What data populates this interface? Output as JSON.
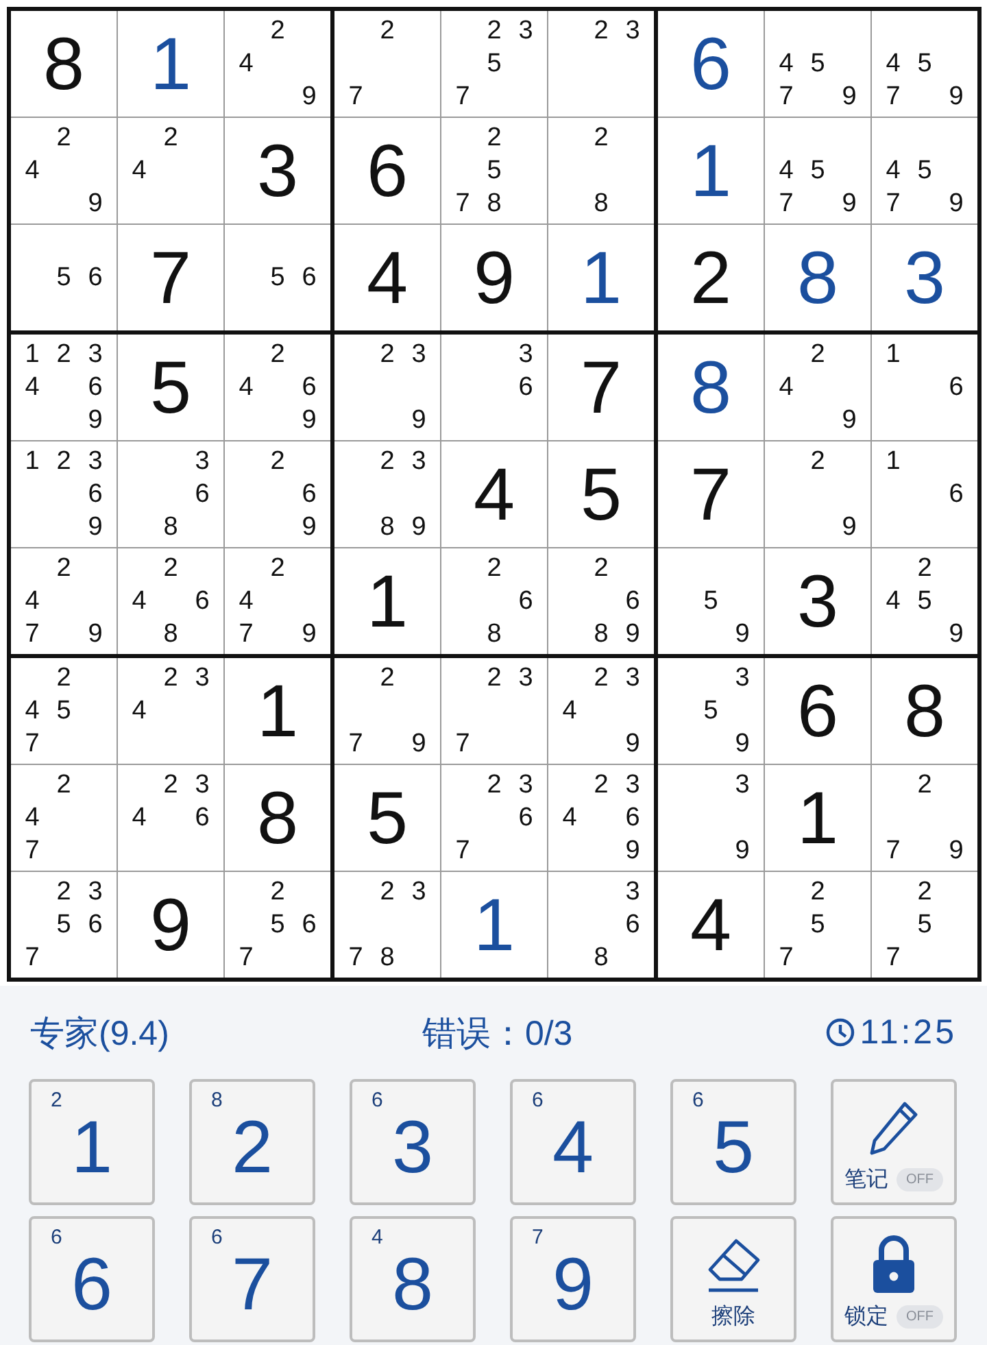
{
  "board": {
    "rows": [
      [
        {
          "kind": "given",
          "value": "8"
        },
        {
          "kind": "entered",
          "value": "1"
        },
        {
          "kind": "notes",
          "notes": [
            "2",
            "4",
            "9"
          ]
        },
        {
          "kind": "notes",
          "notes": [
            "2",
            "7"
          ]
        },
        {
          "kind": "notes",
          "notes": [
            "2",
            "3",
            "5",
            "7"
          ]
        },
        {
          "kind": "notes",
          "notes": [
            "2",
            "3"
          ]
        },
        {
          "kind": "entered",
          "value": "6"
        },
        {
          "kind": "notes",
          "notes": [
            "4",
            "5",
            "7",
            "9"
          ]
        },
        {
          "kind": "notes",
          "notes": [
            "4",
            "5",
            "7",
            "9"
          ]
        }
      ],
      [
        {
          "kind": "notes",
          "notes": [
            "2",
            "4",
            "9"
          ]
        },
        {
          "kind": "notes",
          "notes": [
            "2",
            "4"
          ]
        },
        {
          "kind": "given",
          "value": "3"
        },
        {
          "kind": "given",
          "value": "6"
        },
        {
          "kind": "notes",
          "notes": [
            "2",
            "5",
            "7",
            "8"
          ]
        },
        {
          "kind": "notes",
          "notes": [
            "2",
            "8"
          ]
        },
        {
          "kind": "entered",
          "value": "1"
        },
        {
          "kind": "notes",
          "notes": [
            "4",
            "5",
            "7",
            "9"
          ]
        },
        {
          "kind": "notes",
          "notes": [
            "4",
            "5",
            "7",
            "9"
          ]
        }
      ],
      [
        {
          "kind": "notes",
          "notes": [
            "5",
            "6"
          ]
        },
        {
          "kind": "given",
          "value": "7"
        },
        {
          "kind": "notes",
          "notes": [
            "5",
            "6"
          ]
        },
        {
          "kind": "given",
          "value": "4"
        },
        {
          "kind": "given",
          "value": "9"
        },
        {
          "kind": "entered",
          "value": "1"
        },
        {
          "kind": "given",
          "value": "2"
        },
        {
          "kind": "entered",
          "value": "8"
        },
        {
          "kind": "entered",
          "value": "3"
        }
      ],
      [
        {
          "kind": "notes",
          "notes": [
            "1",
            "2",
            "3",
            "4",
            "6",
            "9"
          ]
        },
        {
          "kind": "given",
          "value": "5"
        },
        {
          "kind": "notes",
          "notes": [
            "2",
            "4",
            "6",
            "9"
          ]
        },
        {
          "kind": "notes",
          "notes": [
            "2",
            "3",
            "9"
          ]
        },
        {
          "kind": "notes",
          "notes": [
            "3",
            "6"
          ]
        },
        {
          "kind": "given",
          "value": "7"
        },
        {
          "kind": "entered",
          "value": "8"
        },
        {
          "kind": "notes",
          "notes": [
            "2",
            "4",
            "9"
          ]
        },
        {
          "kind": "notes",
          "notes": [
            "1",
            "6"
          ]
        }
      ],
      [
        {
          "kind": "notes",
          "notes": [
            "1",
            "2",
            "3",
            "6",
            "9"
          ]
        },
        {
          "kind": "notes",
          "notes": [
            "3",
            "6",
            "8"
          ]
        },
        {
          "kind": "notes",
          "notes": [
            "2",
            "6",
            "9"
          ]
        },
        {
          "kind": "notes",
          "notes": [
            "2",
            "3",
            "8",
            "9"
          ]
        },
        {
          "kind": "given",
          "value": "4"
        },
        {
          "kind": "given",
          "value": "5"
        },
        {
          "kind": "given",
          "value": "7"
        },
        {
          "kind": "notes",
          "notes": [
            "2",
            "9"
          ]
        },
        {
          "kind": "notes",
          "notes": [
            "1",
            "6"
          ]
        }
      ],
      [
        {
          "kind": "notes",
          "notes": [
            "2",
            "4",
            "7",
            "9"
          ]
        },
        {
          "kind": "notes",
          "notes": [
            "2",
            "4",
            "6",
            "8"
          ]
        },
        {
          "kind": "notes",
          "notes": [
            "2",
            "4",
            "7",
            "9"
          ]
        },
        {
          "kind": "given",
          "value": "1"
        },
        {
          "kind": "notes",
          "notes": [
            "2",
            "6",
            "8"
          ]
        },
        {
          "kind": "notes",
          "notes": [
            "2",
            "6",
            "8",
            "9"
          ]
        },
        {
          "kind": "notes",
          "notes": [
            "5",
            "9"
          ]
        },
        {
          "kind": "given",
          "value": "3"
        },
        {
          "kind": "notes",
          "notes": [
            "2",
            "4",
            "5",
            "9"
          ]
        }
      ],
      [
        {
          "kind": "notes",
          "notes": [
            "2",
            "4",
            "5",
            "7"
          ]
        },
        {
          "kind": "notes",
          "notes": [
            "2",
            "3",
            "4"
          ]
        },
        {
          "kind": "given",
          "value": "1"
        },
        {
          "kind": "notes",
          "notes": [
            "2",
            "7",
            "9"
          ]
        },
        {
          "kind": "notes",
          "notes": [
            "2",
            "3",
            "7"
          ]
        },
        {
          "kind": "notes",
          "notes": [
            "2",
            "3",
            "4",
            "9"
          ]
        },
        {
          "kind": "notes",
          "notes": [
            "3",
            "5",
            "9"
          ]
        },
        {
          "kind": "given",
          "value": "6"
        },
        {
          "kind": "given",
          "value": "8"
        }
      ],
      [
        {
          "kind": "notes",
          "notes": [
            "2",
            "4",
            "7"
          ]
        },
        {
          "kind": "notes",
          "notes": [
            "2",
            "3",
            "4",
            "6"
          ]
        },
        {
          "kind": "given",
          "value": "8"
        },
        {
          "kind": "given",
          "value": "5"
        },
        {
          "kind": "notes",
          "notes": [
            "2",
            "3",
            "6",
            "7"
          ]
        },
        {
          "kind": "notes",
          "notes": [
            "2",
            "3",
            "4",
            "6",
            "9"
          ]
        },
        {
          "kind": "notes",
          "notes": [
            "3",
            "9"
          ]
        },
        {
          "kind": "given",
          "value": "1"
        },
        {
          "kind": "notes",
          "notes": [
            "2",
            "7",
            "9"
          ]
        }
      ],
      [
        {
          "kind": "notes",
          "notes": [
            "2",
            "3",
            "5",
            "6",
            "7"
          ]
        },
        {
          "kind": "given",
          "value": "9"
        },
        {
          "kind": "notes",
          "notes": [
            "2",
            "5",
            "6",
            "7"
          ]
        },
        {
          "kind": "notes",
          "notes": [
            "2",
            "3",
            "7",
            "8"
          ]
        },
        {
          "kind": "entered",
          "value": "1"
        },
        {
          "kind": "notes",
          "notes": [
            "3",
            "6",
            "8"
          ]
        },
        {
          "kind": "given",
          "value": "4"
        },
        {
          "kind": "notes",
          "notes": [
            "2",
            "5",
            "7"
          ]
        },
        {
          "kind": "notes",
          "notes": [
            "2",
            "5",
            "7"
          ]
        }
      ]
    ]
  },
  "status": {
    "difficulty": "专家(9.4)",
    "mistakes": "错误：0/3",
    "timer": "11:25"
  },
  "keys": [
    {
      "digit": "1",
      "count": "2"
    },
    {
      "digit": "2",
      "count": "8"
    },
    {
      "digit": "3",
      "count": "6"
    },
    {
      "digit": "4",
      "count": "6"
    },
    {
      "digit": "5",
      "count": "6"
    },
    {
      "digit": "6",
      "count": "6"
    },
    {
      "digit": "7",
      "count": "6"
    },
    {
      "digit": "8",
      "count": "4"
    },
    {
      "digit": "9",
      "count": "7"
    }
  ],
  "tools": [
    {
      "kind": "notes",
      "label": "笔记",
      "toggle": "OFF",
      "on": false
    },
    {
      "kind": "erase",
      "label": "擦除"
    },
    {
      "kind": "lock",
      "label": "锁定",
      "toggle": "OFF",
      "on": false
    }
  ]
}
